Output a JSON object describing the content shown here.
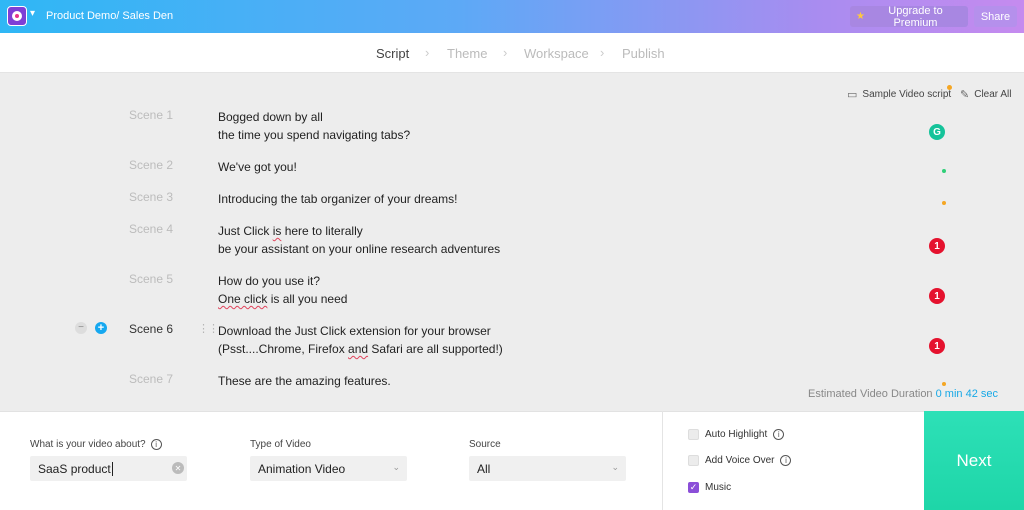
{
  "header": {
    "project_title": "Product Demo/ Sales Den",
    "upgrade_label": "Upgrade to Premium",
    "share_label": "Share",
    "logo_icon": "app-logo-icon",
    "caret_icon": "chevron-down-icon"
  },
  "steps": [
    "Script",
    "Theme",
    "Workspace",
    "Publish"
  ],
  "active_step": "Script",
  "tools": {
    "sample_label": "Sample Video script",
    "clear_label": "Clear All"
  },
  "scenes": [
    {
      "label": "Scene 1",
      "lines": [
        "Bogged down by all",
        "the time you spend navigating tabs?"
      ]
    },
    {
      "label": "Scene 2",
      "lines": [
        "We've got you!"
      ]
    },
    {
      "label": "Scene 3",
      "lines": [
        "Introducing the tab organizer of your dreams!"
      ]
    },
    {
      "label": "Scene 4",
      "lines": [
        "Just Click is here to literally",
        "be your assistant on your online research adventures"
      ]
    },
    {
      "label": "Scene 5",
      "lines": [
        "How do you use it?",
        "One click is all you need"
      ]
    },
    {
      "label": "Scene 6",
      "lines": [
        "Download the Just Click extension for your browser",
        "(Psst....Chrome, Firefox and Safari are all supported!)"
      ]
    },
    {
      "label": "Scene 7",
      "lines": [
        "These are the amazing features."
      ]
    }
  ],
  "badges": {
    "error_count": "1",
    "grammarly_letter": "G"
  },
  "duration": {
    "label": "Estimated Video Duration",
    "value": "0 min 42 sec"
  },
  "form": {
    "about_label": "What is your video about?",
    "about_value": "SaaS product",
    "type_label": "Type of Video",
    "type_value": "Animation Video",
    "source_label": "Source",
    "source_value": "All",
    "auto_highlight_label": "Auto Highlight",
    "voice_over_label": "Add Voice Over",
    "music_label": "Music",
    "auto_highlight_checked": false,
    "voice_over_checked": false,
    "music_checked": true
  },
  "next_label": "Next",
  "colors": {
    "accent_blue": "#2fb7f5",
    "accent_purple": "#c58bef",
    "next_green": "#1ed6a8",
    "error_red": "#e5122e"
  }
}
